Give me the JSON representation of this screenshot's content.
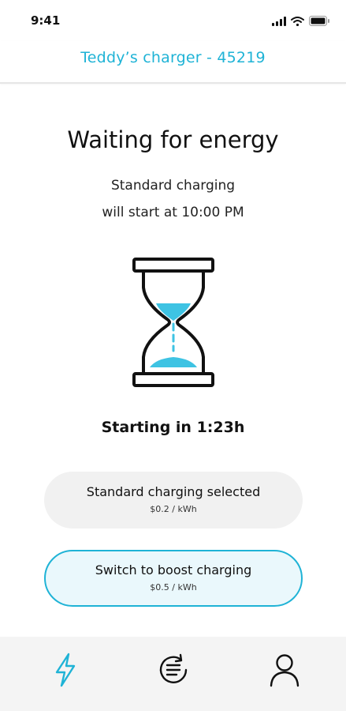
{
  "status_bar": {
    "time": "9:41"
  },
  "header": {
    "title": "Teddy’s charger - 45219"
  },
  "main": {
    "title": "Waiting for energy",
    "subtitle_line1": "Standard charging",
    "subtitle_line2": "will start at 10:00 PM",
    "countdown": "Starting in 1:23h"
  },
  "options": {
    "standard": {
      "label": "Standard charging selected",
      "price": "$0.2 / kWh"
    },
    "boost": {
      "label": "Switch to boost charging",
      "price": "$0.5 / kWh"
    }
  },
  "tab_bar": {
    "icons": [
      "lightning-icon",
      "history-refresh-icon",
      "user-icon"
    ],
    "active": "lightning-icon"
  },
  "colors": {
    "accent": "#1fb3d6",
    "text": "#111111",
    "option_bg": "#f1f1f1",
    "tab_bar_bg": "#f4f4f4"
  }
}
